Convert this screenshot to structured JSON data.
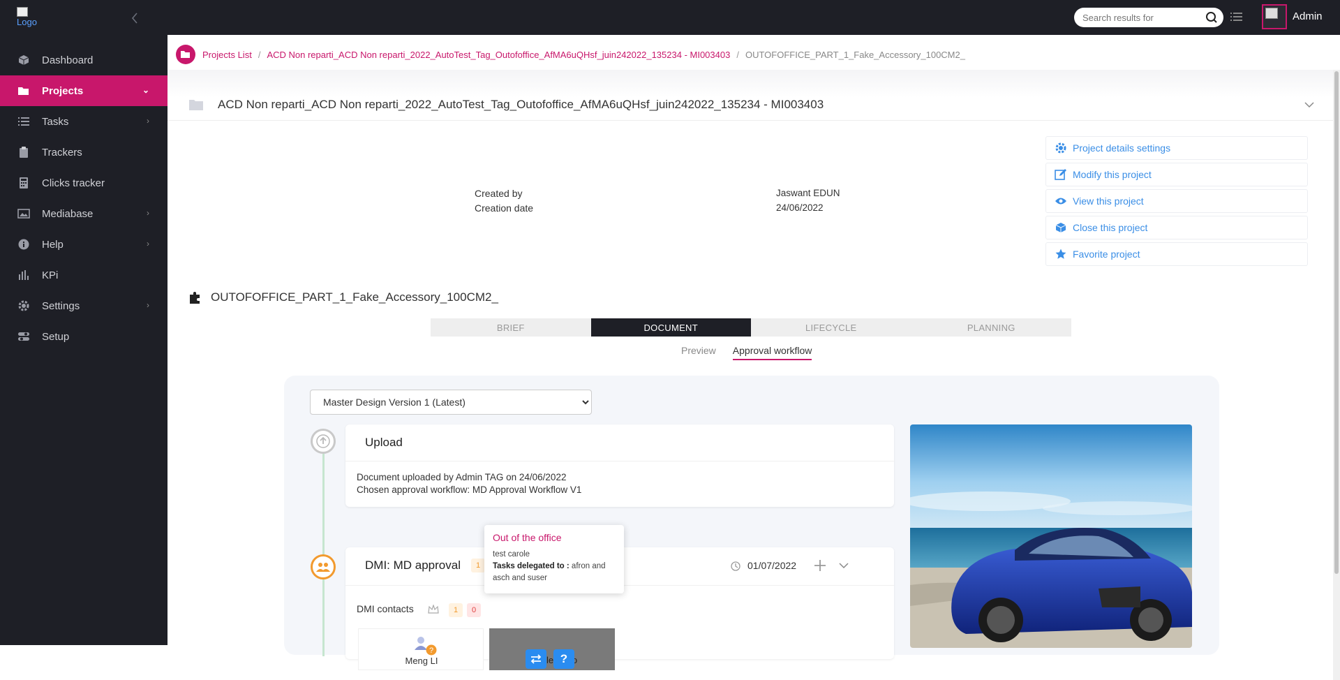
{
  "app": {
    "logo_alt": "Logo"
  },
  "sidebar": {
    "items": [
      {
        "label": "Dashboard",
        "icon": "cube-icon"
      },
      {
        "label": "Projects",
        "icon": "folder-open-icon",
        "active": true
      },
      {
        "label": "Tasks",
        "icon": "list-icon"
      },
      {
        "label": "Trackers",
        "icon": "clipboard-icon"
      },
      {
        "label": "Clicks tracker",
        "icon": "calculator-icon"
      },
      {
        "label": "Mediabase",
        "icon": "image-icon"
      },
      {
        "label": "Help",
        "icon": "info-icon"
      },
      {
        "label": "KPi",
        "icon": "bar-chart-icon"
      },
      {
        "label": "Settings",
        "icon": "gear-icon"
      },
      {
        "label": "Setup",
        "icon": "toggle-icon"
      }
    ]
  },
  "topbar": {
    "search_placeholder": "Search results for",
    "user_name": "Admin"
  },
  "breadcrumb": {
    "items": [
      "Projects List",
      "ACD Non reparti_ACD Non reparti_2022_AutoTest_Tag_Outofoffice_AfMA6uQHsf_juin242022_135234 - MI003403",
      "OUTOFOFFICE_PART_1_Fake_Accessory_100CM2_"
    ]
  },
  "project": {
    "title": "ACD Non reparti_ACD Non reparti_2022_AutoTest_Tag_Outofoffice_AfMA6uQHsf_juin242022_135234 - MI003403",
    "created_by_label": "Created by",
    "created_by_value": "Jaswant EDUN",
    "creation_date_label": "Creation date",
    "creation_date_value": "24/06/2022"
  },
  "actions": [
    {
      "label": "Project details settings",
      "icon": "gear-icon"
    },
    {
      "label": "Modify this project",
      "icon": "edit-icon"
    },
    {
      "label": "View this project",
      "icon": "eye-icon"
    },
    {
      "label": "Close this project",
      "icon": "box-icon"
    },
    {
      "label": "Favorite project",
      "icon": "star-icon"
    }
  ],
  "part": {
    "title": "OUTOFOFFICE_PART_1_Fake_Accessory_100CM2_"
  },
  "tabs": [
    "BRIEF",
    "DOCUMENT",
    "LIFECYCLE",
    "PLANNING"
  ],
  "subtabs": [
    "Preview",
    "Approval workflow"
  ],
  "workflow": {
    "version_selected": "Master Design Version 1 (Latest)",
    "upload": {
      "title": "Upload",
      "line1": "Document uploaded by Admin TAG on 24/06/2022",
      "line2": "Chosen approval workflow: MD Approval Workflow V1"
    },
    "approval": {
      "title": "DMI: MD approval",
      "badge_count": "1",
      "date": "01/07/2022",
      "contacts_label": "DMI contacts",
      "contacts_badge_1": "1",
      "contacts_badge_2": "0",
      "contact_1": "Meng LI",
      "contact_2": "Carole Bono"
    }
  },
  "tooltip": {
    "title": "Out of the office",
    "user": "test carole",
    "delegated_label": "Tasks delegated to :",
    "delegated_value": "afron and asch and suser"
  },
  "colors": {
    "accent": "#c8176b",
    "sidebar_bg": "#1e1f26",
    "link_blue": "#3a8ee6",
    "orange": "#f29a2e"
  }
}
